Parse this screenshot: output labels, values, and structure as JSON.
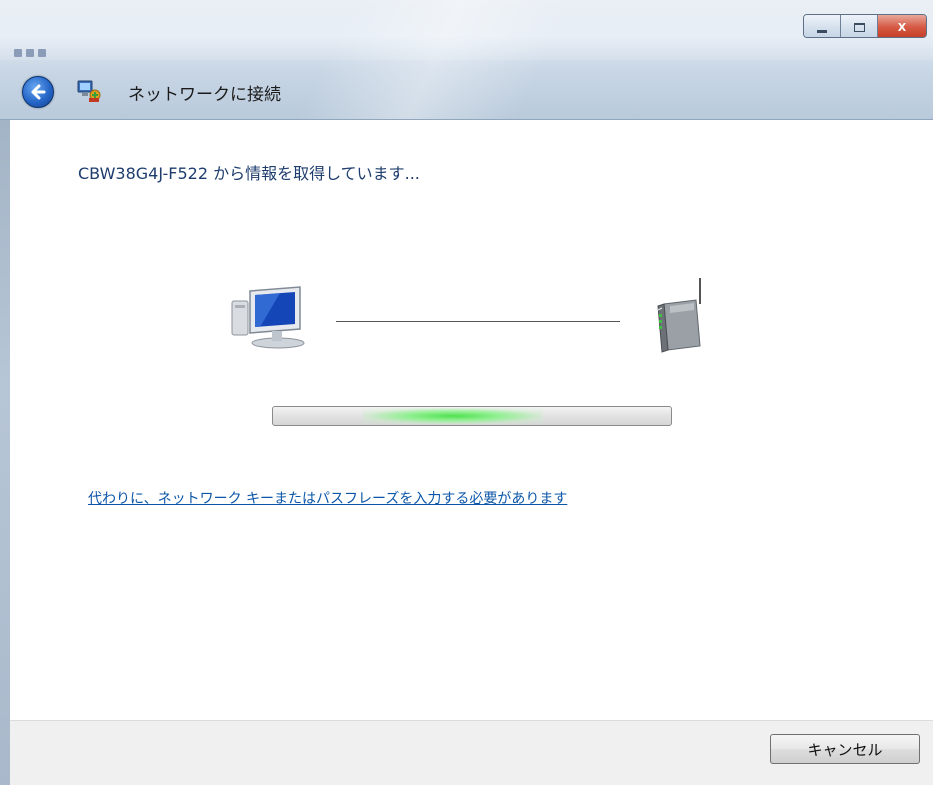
{
  "window": {
    "title": "ネットワークに接続"
  },
  "caption_buttons": {
    "close_glyph": "X"
  },
  "main": {
    "status_text": "CBW38G4J-F522 から情報を取得しています...",
    "passphrase_link": "代わりに、ネットワーク キーまたはパスフレーズを入力する必要があります",
    "progress_mode": "indeterminate"
  },
  "footer": {
    "cancel_label": "キャンセル"
  },
  "icons": {
    "back": "back-arrow-icon",
    "app": "network-connect-icon",
    "computer": "computer-icon",
    "router": "wireless-router-icon"
  },
  "colors": {
    "link": "#0b56a8",
    "heading": "#1e3d6e",
    "progress_glow": "#4fe04f",
    "close_button": "#c23a22"
  }
}
